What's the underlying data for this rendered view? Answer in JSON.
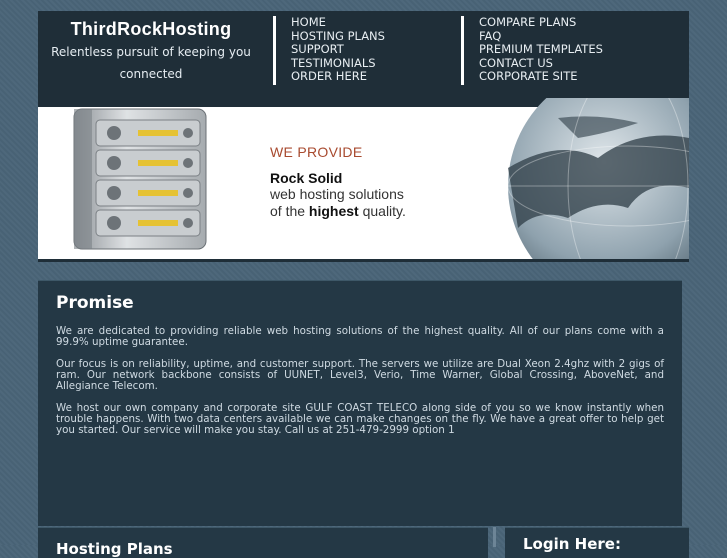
{
  "brand": {
    "name": "ThirdRockHosting",
    "tagline": "Relentless pursuit of keeping you connected"
  },
  "nav": {
    "col1": [
      "HOME",
      "HOSTING PLANS",
      "SUPPORT",
      "TESTIMONIALS",
      "ORDER HERE"
    ],
    "col2": [
      "COMPARE PLANS",
      "FAQ",
      "PREMIUM TEMPLATES",
      "CONTACT US",
      "CORPORATE SITE"
    ]
  },
  "banner": {
    "provide": "WE PROVIDE",
    "rock": "Rock Solid",
    "line1": "web hosting solutions",
    "line2_pre": "of the ",
    "line2_bold": "highest",
    "line2_post": " quality."
  },
  "promise": {
    "title": "Promise",
    "p1": "We are dedicated to providing reliable web hosting solutions of the highest quality. All of our plans come with a 99.9% uptime guarantee.",
    "p2": "Our focus is on reliability, uptime, and customer support. The servers we utilize are Dual Xeon 2.4ghz with 2 gigs of ram. Our network backbone consists of UUNET, Level3, Verio, Time Warner, Global Crossing, AboveNet, and Allegiance Telecom.",
    "p3": "We host our own company and corporate site GULF COAST TELECO along side of you so we know instantly when trouble happens. With two data centers available we can make changes on the fly. We have a great offer to help get you started. Our service will make you stay. Call us at 251-479-2999 option 1"
  },
  "bottom": {
    "left_title": "Hosting Plans",
    "right_title": "Login Here:"
  },
  "colors": {
    "header_bg": "#1f2e38",
    "content_bg": "#243845",
    "page_bg": "#4a6478",
    "accent_red": "#a84a2f"
  }
}
